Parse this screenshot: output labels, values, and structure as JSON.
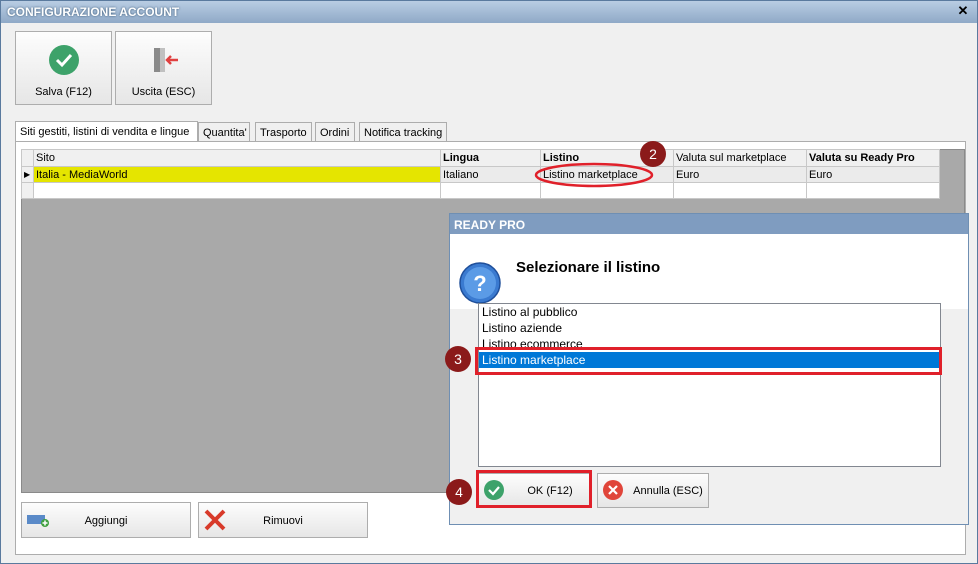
{
  "window": {
    "title": "CONFIGURAZIONE ACCOUNT",
    "close_glyph": "✕"
  },
  "toolbar": {
    "save_label": "Salva (F12)",
    "exit_label": "Uscita (ESC)"
  },
  "tabs": [
    {
      "label": "Siti gestiti, listini di vendita e lingue"
    },
    {
      "label": "Quantita'"
    },
    {
      "label": "Trasporto"
    },
    {
      "label": "Ordini"
    },
    {
      "label": "Notifica tracking"
    }
  ],
  "grid": {
    "headers": [
      "Sito",
      "Lingua",
      "Listino",
      "Valuta sul marketplace",
      "Valuta su Ready Pro"
    ],
    "rows": [
      {
        "sito": "Italia - MediaWorld",
        "lingua": "Italiano",
        "listino": "Listino marketplace",
        "valuta_mp": "Euro",
        "valuta_rp": "Euro"
      }
    ]
  },
  "bottom": {
    "add_label": "Aggiungi",
    "remove_label": "Rimuovi"
  },
  "dialog": {
    "title": "READY PRO",
    "message": "Selezionare il listino",
    "items": [
      "Listino al pubblico",
      "Listino aziende",
      "Listino ecommerce",
      "Listino marketplace"
    ],
    "selected_index": 3,
    "ok_label": "OK (F12)",
    "cancel_label": "Annulla (ESC)"
  },
  "annotations": {
    "step2": "2",
    "step3": "3",
    "step4": "4"
  },
  "colors": {
    "highlight_row": "#e5e500",
    "selection": "#0078d7",
    "callout": "#e0202a",
    "badge": "#8b1a1a"
  }
}
